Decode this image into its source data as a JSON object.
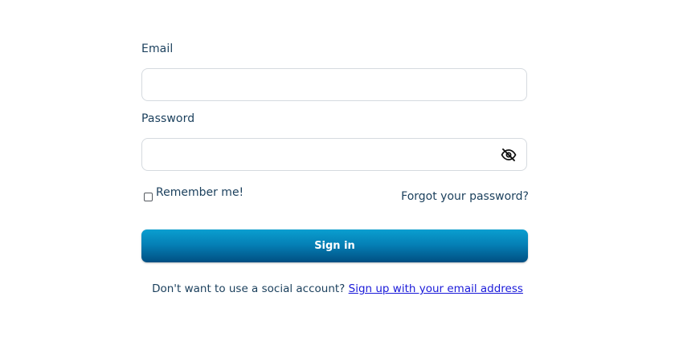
{
  "form": {
    "email_label": "Email",
    "email_value": "",
    "password_label": "Password",
    "password_value": "",
    "password_toggle_icon": "eye-slash-icon",
    "remember_label": "Remember me!",
    "remember_checked": false,
    "forgot_link": "Forgot your password?",
    "signin_label": "Sign in"
  },
  "footer": {
    "prompt": "Don't want to use a social account?",
    "signup_link": "Sign up with your email address"
  },
  "colors": {
    "text": "#1a3f5c",
    "button_top": "#0a9fd0",
    "button_bottom": "#004f82",
    "link": "#1a1ad9",
    "field_border": "#d5dadf"
  }
}
